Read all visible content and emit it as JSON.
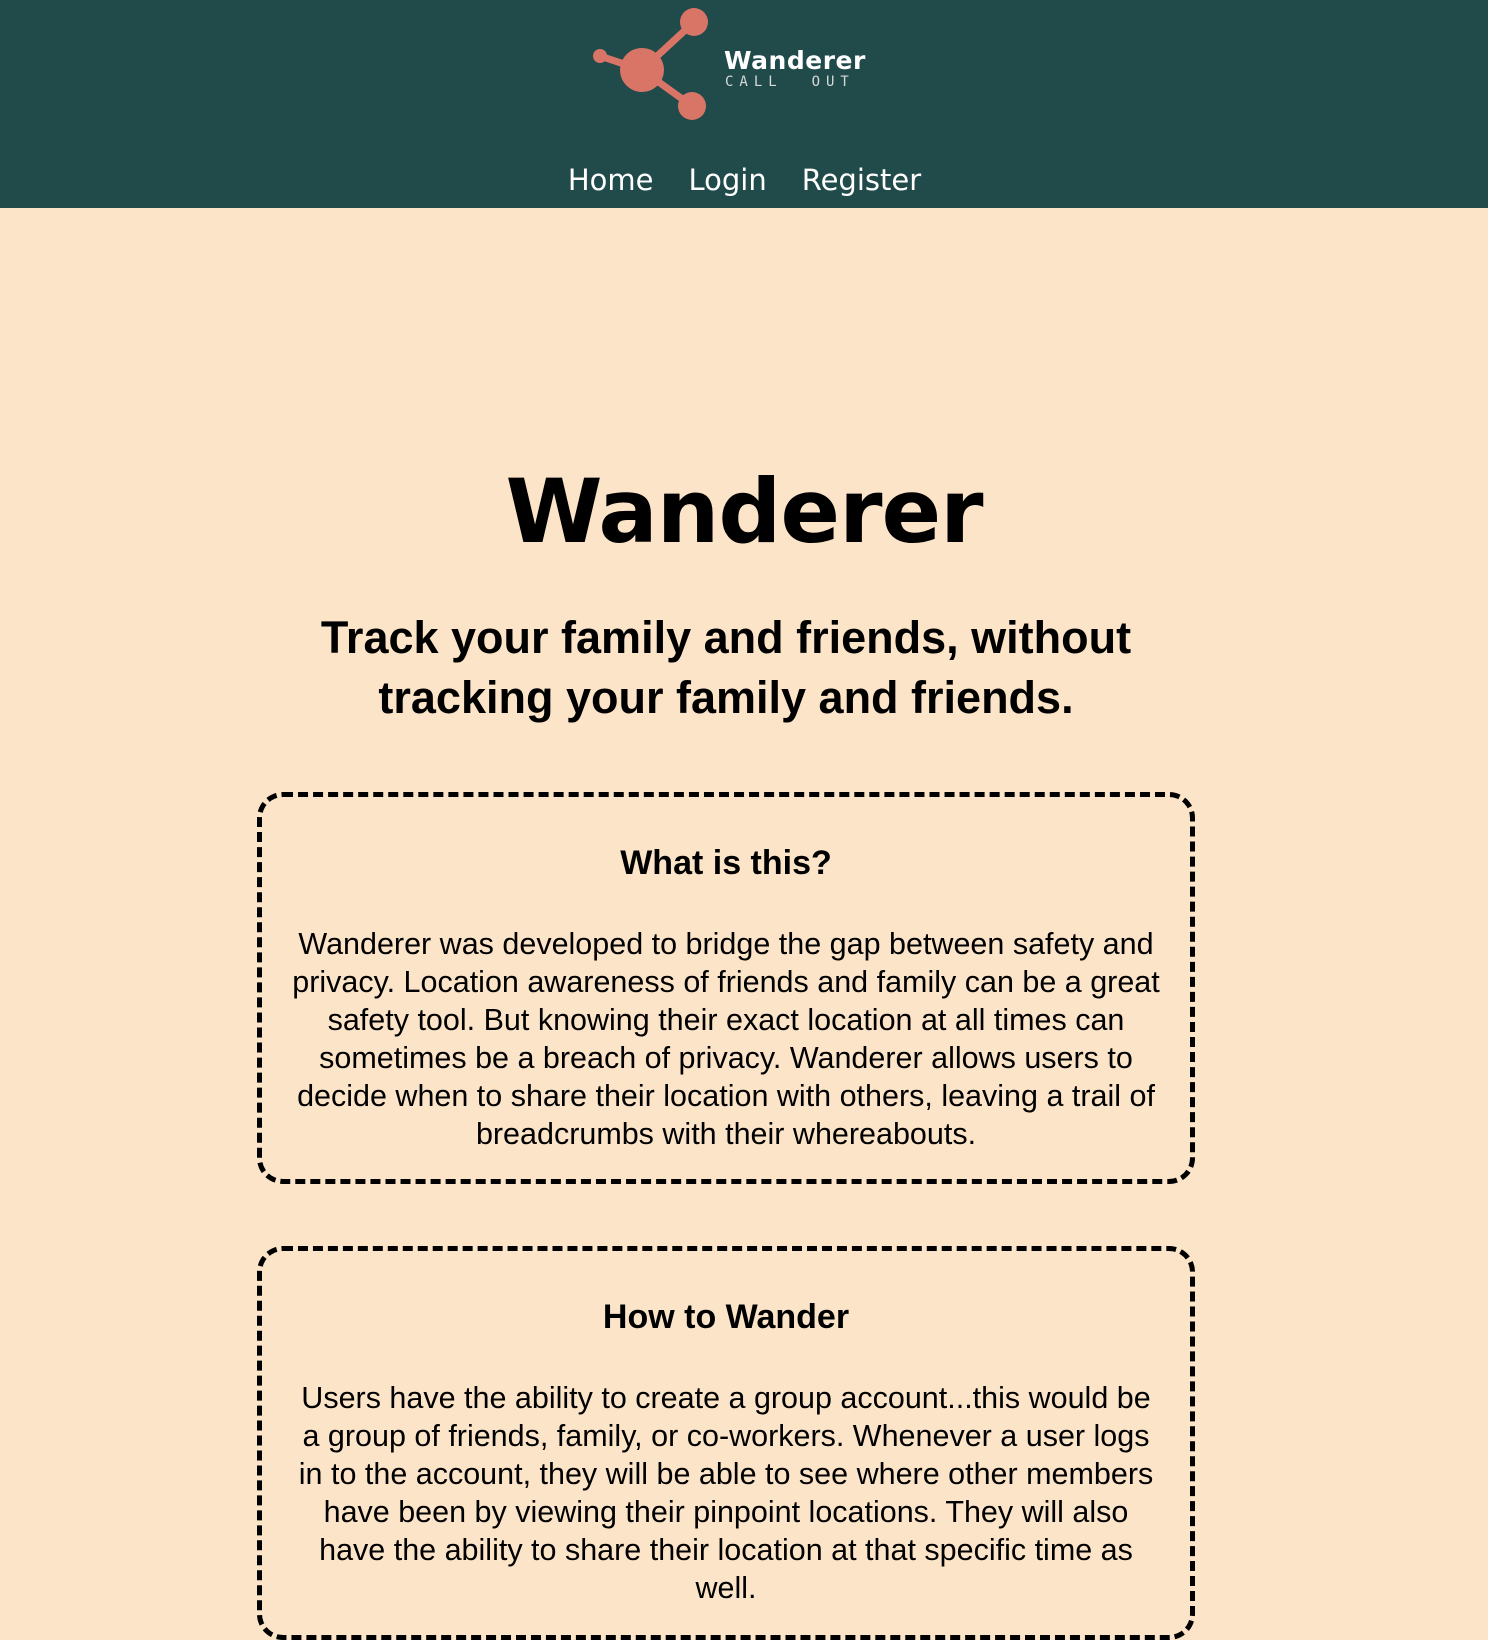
{
  "header": {
    "logo": {
      "title": "Wanderer",
      "subtitle": "CALL  OUT",
      "icon": "molecule-icon",
      "icon_color": "#d97567"
    },
    "nav": {
      "home": "Home",
      "login": "Login",
      "register": "Register"
    },
    "background": "#214a4a"
  },
  "main": {
    "title": "Wanderer",
    "tagline": "Track your family and friends, without tracking your family and friends.",
    "background": "#fce4c9",
    "cards": [
      {
        "heading": "What is this?",
        "body": "Wanderer was developed to bridge the gap between safety and privacy. Location awareness of friends and family can be a great safety tool. But knowing their exact location at all times can sometimes be a breach of privacy. Wanderer allows users to decide when to share their location with others, leaving a trail of breadcrumbs with their whereabouts."
      },
      {
        "heading": "How to Wander",
        "body": "Users have the ability to create a group account...this would be a group of friends, family, or co-workers. Whenever a user logs in to the account, they will be able to see where other members have been by viewing their pinpoint locations. They will also have the ability to share their location at that specific time as well."
      }
    ]
  }
}
